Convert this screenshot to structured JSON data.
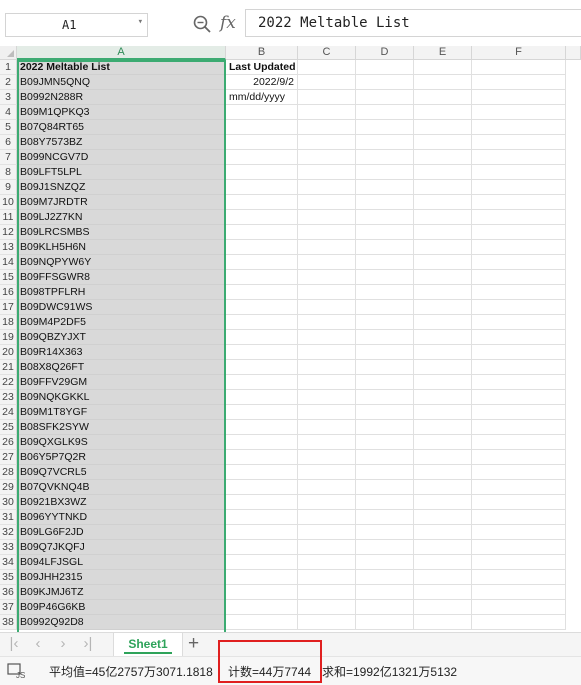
{
  "formula_bar": {
    "name_box": "A1",
    "fx_label": "fx",
    "formula": "2022 Meltable List"
  },
  "columns": [
    "A",
    "B",
    "C",
    "D",
    "E",
    "F"
  ],
  "rows": [
    {
      "n": "1",
      "a": "2022 Meltable List",
      "b": "Last Updated"
    },
    {
      "n": "2",
      "a": "B09JMN5QNQ",
      "b": "2022/9/2"
    },
    {
      "n": "3",
      "a": "B0992N288R",
      "b": "mm/dd/yyyy"
    },
    {
      "n": "4",
      "a": "B09M1QPKQ3",
      "b": ""
    },
    {
      "n": "5",
      "a": "B07Q84RT65",
      "b": ""
    },
    {
      "n": "6",
      "a": "B08Y7573BZ",
      "b": ""
    },
    {
      "n": "7",
      "a": "B099NCGV7D",
      "b": ""
    },
    {
      "n": "8",
      "a": "B09LFT5LPL",
      "b": ""
    },
    {
      "n": "9",
      "a": "B09J1SNZQZ",
      "b": ""
    },
    {
      "n": "10",
      "a": "B09M7JRDTR",
      "b": ""
    },
    {
      "n": "11",
      "a": "B09LJ2Z7KN",
      "b": ""
    },
    {
      "n": "12",
      "a": "B09LRCSMBS",
      "b": ""
    },
    {
      "n": "13",
      "a": "B09KLH5H6N",
      "b": ""
    },
    {
      "n": "14",
      "a": "B09NQPYW6Y",
      "b": ""
    },
    {
      "n": "15",
      "a": "B09FFSGWR8",
      "b": ""
    },
    {
      "n": "16",
      "a": "B098TPFLRH",
      "b": ""
    },
    {
      "n": "17",
      "a": "B09DWC91WS",
      "b": ""
    },
    {
      "n": "18",
      "a": "B09M4P2DF5",
      "b": ""
    },
    {
      "n": "19",
      "a": "B09QBZYJXT",
      "b": ""
    },
    {
      "n": "20",
      "a": "B09R14X363",
      "b": ""
    },
    {
      "n": "21",
      "a": "B08X8Q26FT",
      "b": ""
    },
    {
      "n": "22",
      "a": "B09FFV29GM",
      "b": ""
    },
    {
      "n": "23",
      "a": "B09NQKGKKL",
      "b": ""
    },
    {
      "n": "24",
      "a": "B09M1T8YGF",
      "b": ""
    },
    {
      "n": "25",
      "a": "B08SFK2SYW",
      "b": ""
    },
    {
      "n": "26",
      "a": "B09QXGLK9S",
      "b": ""
    },
    {
      "n": "27",
      "a": "B06Y5P7Q2R",
      "b": ""
    },
    {
      "n": "28",
      "a": "B09Q7VCRL5",
      "b": ""
    },
    {
      "n": "29",
      "a": "B07QVKNQ4B",
      "b": ""
    },
    {
      "n": "30",
      "a": "B0921BX3WZ",
      "b": ""
    },
    {
      "n": "31",
      "a": "B096YYTNKD",
      "b": ""
    },
    {
      "n": "32",
      "a": "B09LG6F2JD",
      "b": ""
    },
    {
      "n": "33",
      "a": "B09Q7JKQFJ",
      "b": ""
    },
    {
      "n": "34",
      "a": "B094LFJSGL",
      "b": ""
    },
    {
      "n": "35",
      "a": "B09JHH2315",
      "b": ""
    },
    {
      "n": "36",
      "a": "B09KJMJ6TZ",
      "b": ""
    },
    {
      "n": "37",
      "a": "B09P46G6KB",
      "b": ""
    },
    {
      "n": "38",
      "a": "B0992Q92D8",
      "b": ""
    }
  ],
  "sheet_tabs": {
    "active": "Sheet1",
    "add_label": "+"
  },
  "status_bar": {
    "average": "平均值=45亿2757万3071.1818",
    "count": "计数=44万7744",
    "sum": "求和=1992亿1321万5132"
  },
  "colors": {
    "selection": "#3cab72",
    "active_tab": "#2ea35a",
    "highlight_box": "#e02020"
  },
  "icons": [
    "zoom-formula-icon",
    "first-sheet-icon",
    "prev-sheet-icon",
    "next-sheet-icon",
    "last-sheet-icon",
    "macro-record-icon"
  ]
}
